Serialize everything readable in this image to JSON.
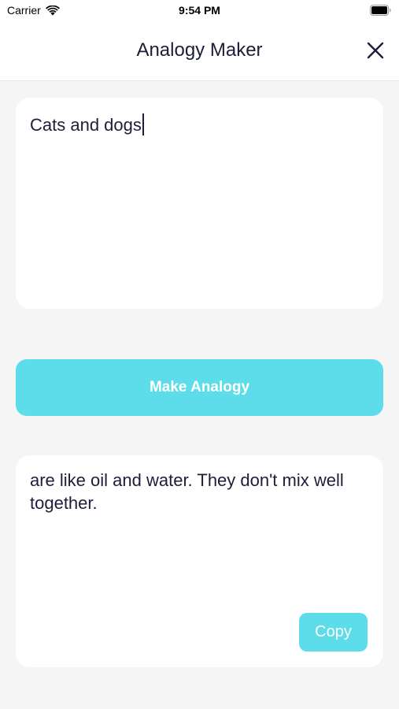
{
  "status_bar": {
    "carrier": "Carrier",
    "time": "9:54 PM"
  },
  "nav": {
    "title": "Analogy Maker",
    "close_icon": "close-icon"
  },
  "input": {
    "value": "Cats and dogs"
  },
  "make_button": {
    "label": "Make Analogy"
  },
  "output": {
    "text": "are like oil and water. They don't mix well together.",
    "copy_label": "Copy"
  },
  "colors": {
    "accent": "#5ddce9",
    "text": "#1c1e3a",
    "background": "#f5f5f5",
    "card": "#ffffff"
  }
}
